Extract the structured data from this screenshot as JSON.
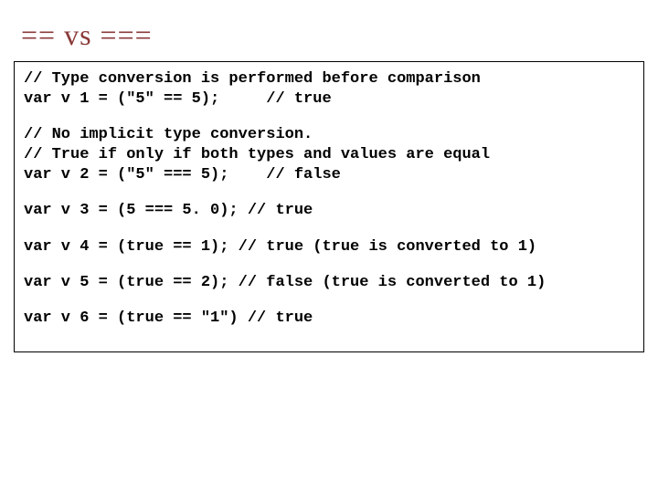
{
  "title": "== vs ===",
  "code": {
    "l1": "// Type conversion is performed before comparison",
    "l2": "var v 1 = (\"5\" == 5);     // true",
    "l3": "// No implicit type conversion.",
    "l4": "// True if only if both types and values are equal",
    "l5": "var v 2 = (\"5\" === 5);    // false",
    "l6": "var v 3 = (5 === 5. 0); // true",
    "l7": "var v 4 = (true == 1); // true (true is converted to 1)",
    "l8": "var v 5 = (true == 2); // false (true is converted to 1)",
    "l9": "var v 6 = (true == \"1\") // true"
  }
}
